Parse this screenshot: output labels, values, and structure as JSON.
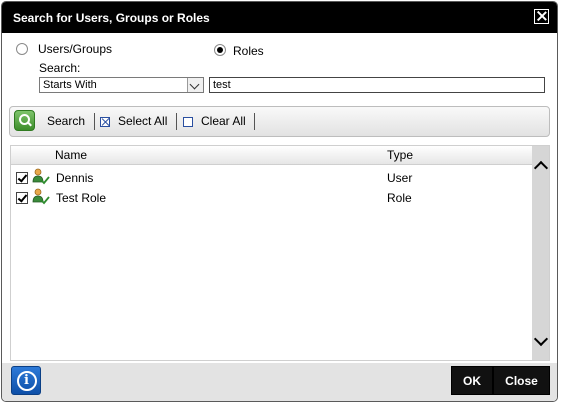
{
  "dialog": {
    "title": "Search for Users, Groups or Roles"
  },
  "search_mode": {
    "options": [
      {
        "label": "Users/Groups",
        "selected": false
      },
      {
        "label": "Roles",
        "selected": true
      }
    ]
  },
  "search": {
    "label": "Search:",
    "match_select": "Starts With",
    "query": "test"
  },
  "toolbar": {
    "search_label": "Search",
    "select_all_label": "Select All",
    "clear_all_label": "Clear All"
  },
  "results": {
    "columns": [
      "Name",
      "Type"
    ],
    "rows": [
      {
        "name": "Dennis",
        "type": "User",
        "checked": true
      },
      {
        "name": "Test Role",
        "type": "Role",
        "checked": true
      }
    ]
  },
  "footer": {
    "info_symbol": "i",
    "ok_label": "OK",
    "close_label": "Close"
  },
  "icons": {
    "close": "close-icon",
    "search": "search-icon",
    "select_all": "checked-box-icon",
    "clear_all": "empty-box-icon",
    "row": "user-role-icon",
    "info": "info-icon"
  }
}
